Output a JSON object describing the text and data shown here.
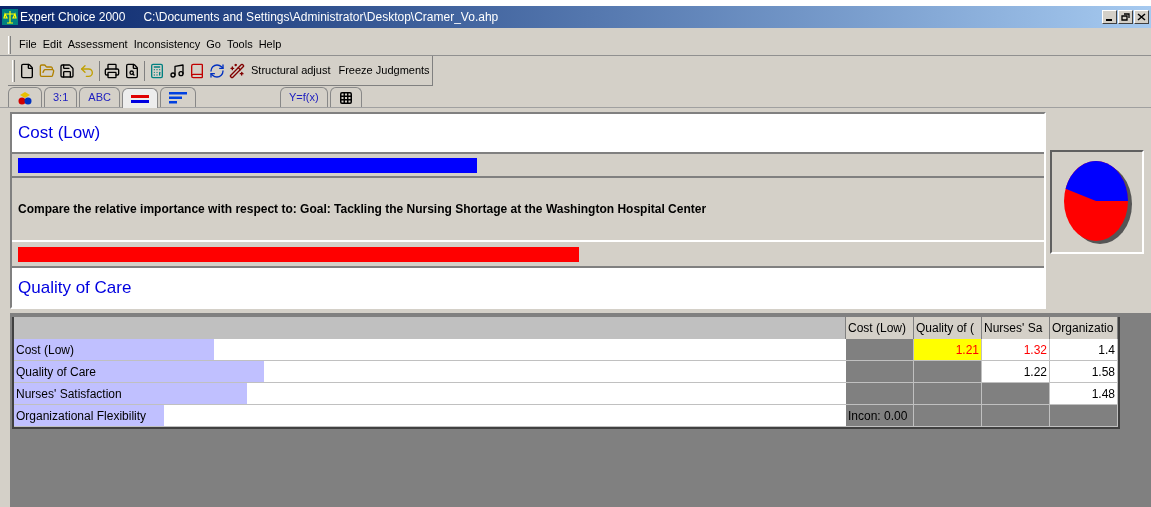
{
  "window": {
    "title": "Expert Choice 2000",
    "path": "C:\\Documents and Settings\\Administrator\\Desktop\\Cramer_Vo.ahp"
  },
  "menu": [
    "File",
    "Edit",
    "Assessment",
    "Inconsistency",
    "Go",
    "Tools",
    "Help"
  ],
  "toolbar": {
    "text_buttons": [
      "Structural adjust",
      "Freeze Judgments"
    ]
  },
  "tabs": [
    {
      "kind": "hierarchy",
      "selected": false
    },
    {
      "kind": "text",
      "label": "3:1",
      "selected": false
    },
    {
      "kind": "text",
      "label": "ABC",
      "selected": false
    },
    {
      "kind": "bars",
      "selected": true
    },
    {
      "kind": "sort",
      "selected": false
    },
    {
      "kind": "text",
      "label": "Y=f(x)",
      "selected": false
    },
    {
      "kind": "grid",
      "selected": false
    }
  ],
  "comparison": {
    "top": {
      "name": "Cost (Low)",
      "level": 0.45
    },
    "prompt": "Compare the relative importance  with respect to: Goal: Tackling the Nursing Shortage at the Washington Hospital Center",
    "bottom": {
      "name": "Quality of Care"
    }
  },
  "matrix": {
    "columns": [
      "Cost (Low)",
      "Quality of (",
      "Nurses' Sa",
      "Organizatio"
    ],
    "rows": [
      {
        "name": "Cost (Low)",
        "level": 0.24,
        "cells": [
          {
            "kind": "blank"
          },
          {
            "kind": "value",
            "text": "1.21",
            "inverse": true,
            "selected": true
          },
          {
            "kind": "value",
            "text": "1.32",
            "inverse": true,
            "selected": false
          },
          {
            "kind": "value",
            "text": "1.4",
            "inverse": false,
            "selected": false
          }
        ]
      },
      {
        "name": "Quality of Care",
        "level": 0.3,
        "cells": [
          {
            "kind": "blank"
          },
          {
            "kind": "blank"
          },
          {
            "kind": "value",
            "text": "1.22",
            "inverse": false,
            "selected": false
          },
          {
            "kind": "value",
            "text": "1.58",
            "inverse": false,
            "selected": false
          }
        ]
      },
      {
        "name": "Nurses' Satisfaction",
        "level": 0.28,
        "cells": [
          {
            "kind": "blank"
          },
          {
            "kind": "blank"
          },
          {
            "kind": "blank"
          },
          {
            "kind": "value",
            "text": "1.48",
            "inverse": false,
            "selected": false
          }
        ]
      },
      {
        "name": "Organizational Flexibility",
        "level": 0.18,
        "cells": [
          {
            "kind": "note",
            "text": "Incon: 0.00"
          },
          {
            "kind": "blank"
          },
          {
            "kind": "blank"
          },
          {
            "kind": "blank"
          }
        ]
      }
    ]
  }
}
